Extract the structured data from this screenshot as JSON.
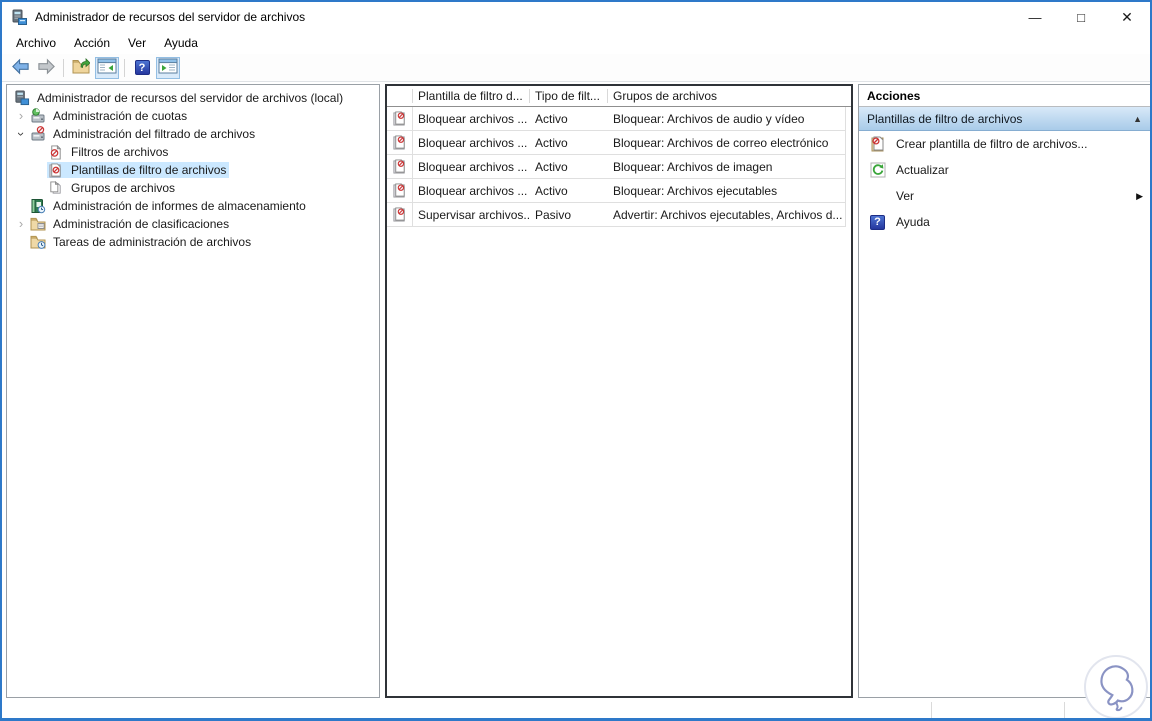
{
  "window": {
    "title": "Administrador de recursos del servidor de archivos",
    "controls": {
      "minimize": "—",
      "maximize": "□",
      "close": "✕"
    },
    "accent_color": "#2e79c9"
  },
  "menu": {
    "items": [
      {
        "label": "Archivo"
      },
      {
        "label": "Acción"
      },
      {
        "label": "Ver"
      },
      {
        "label": "Ayuda"
      }
    ]
  },
  "toolbar": {
    "icons": [
      "back-icon",
      "forward-icon",
      "export-list-icon",
      "show-console-tree-icon",
      "help-icon",
      "show-action-pane-icon"
    ],
    "help_glyph": "?"
  },
  "icons": {
    "chevron": "›"
  },
  "tree": {
    "items": [
      {
        "label": "Administrador de recursos del servidor de archivos (local)",
        "level": 0,
        "expander": "none",
        "icon": "server-icon",
        "selected": false
      },
      {
        "label": "Administración de cuotas",
        "level": 1,
        "expander": "collapsed",
        "icon": "quota-management-icon",
        "selected": false
      },
      {
        "label": "Administración del filtrado de archivos",
        "level": 1,
        "expander": "expanded",
        "icon": "file-screening-management-icon",
        "selected": false
      },
      {
        "label": "Filtros de archivos",
        "level": 2,
        "expander": "none",
        "icon": "file-screen-icon",
        "selected": false
      },
      {
        "label": "Plantillas de filtro de archivos",
        "level": 2,
        "expander": "none",
        "icon": "file-screen-template-icon",
        "selected": true
      },
      {
        "label": "Grupos de archivos",
        "level": 2,
        "expander": "none",
        "icon": "file-groups-icon",
        "selected": false
      },
      {
        "label": "Administración de informes de almacenamiento",
        "level": 1,
        "expander": "none",
        "icon": "storage-reports-icon",
        "selected": false
      },
      {
        "label": "Administración de clasificaciones",
        "level": 1,
        "expander": "collapsed",
        "icon": "classification-icon",
        "selected": false
      },
      {
        "label": "Tareas de administración de archivos",
        "level": 1,
        "expander": "none",
        "icon": "file-tasks-icon",
        "selected": false
      }
    ]
  },
  "main": {
    "table": {
      "columns": [
        "",
        "Plantilla de filtro d...",
        "Tipo de filt...",
        "Grupos de archivos"
      ],
      "rows": [
        {
          "template": "Bloquear archivos ...",
          "type": "Activo",
          "groups": "Bloquear: Archivos de audio y vídeo"
        },
        {
          "template": "Bloquear archivos ...",
          "type": "Activo",
          "groups": "Bloquear: Archivos de correo electrónico"
        },
        {
          "template": "Bloquear archivos ...",
          "type": "Activo",
          "groups": "Bloquear: Archivos de imagen"
        },
        {
          "template": "Bloquear archivos ...",
          "type": "Activo",
          "groups": "Bloquear: Archivos ejecutables"
        },
        {
          "template": "Supervisar archivos...",
          "type": "Pasivo",
          "groups": "Advertir: Archivos ejecutables, Archivos d..."
        }
      ]
    }
  },
  "actions": {
    "title": "Acciones",
    "group": {
      "label": "Plantillas de filtro de archivos",
      "collapse_glyph": "▲"
    },
    "items": [
      {
        "label": "Crear plantilla de filtro de archivos...",
        "icon": "file-screen-template-icon",
        "submenu": ""
      },
      {
        "label": "Actualizar",
        "icon": "refresh-icon",
        "submenu": ""
      },
      {
        "label": "Ver",
        "icon": "",
        "submenu": "▶"
      },
      {
        "label": "Ayuda",
        "icon": "help-icon",
        "submenu": ""
      }
    ]
  }
}
